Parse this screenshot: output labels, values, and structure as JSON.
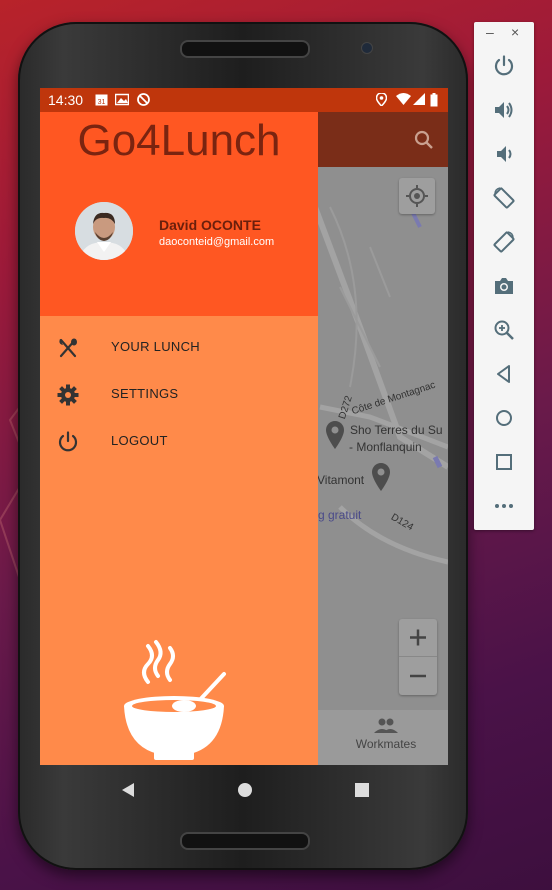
{
  "status_bar": {
    "time": "14:30",
    "calendar_day": "31"
  },
  "drawer": {
    "app_title": "Go4Lunch",
    "user": {
      "name": "David OCONTE",
      "email": "daoconteid@gmail.com"
    },
    "menu": [
      {
        "label": "YOUR LUNCH",
        "icon": "utensils-icon"
      },
      {
        "label": "SETTINGS",
        "icon": "gear-icon"
      },
      {
        "label": "LOGOUT",
        "icon": "power-icon"
      }
    ]
  },
  "map": {
    "labels": [
      "D272",
      "Côte de Montagnac",
      "Sho Terres du Su",
      "- Monflanquin",
      "Vitamont",
      "g gratuit",
      "D124"
    ]
  },
  "bottom_nav": {
    "workmates_label": "Workmates"
  },
  "emulator_panel": {
    "minimize": "–",
    "close": "×",
    "buttons": [
      "power-icon",
      "volume-up-icon",
      "volume-down-icon",
      "rotate-left-icon",
      "rotate-right-icon",
      "camera-icon",
      "zoom-icon",
      "back-icon",
      "home-icon",
      "overview-icon",
      "more-icon"
    ]
  },
  "colors": {
    "drawer_header": "#ff5722",
    "drawer_body": "#ff8a4a",
    "status_bar": "#bf360c"
  }
}
